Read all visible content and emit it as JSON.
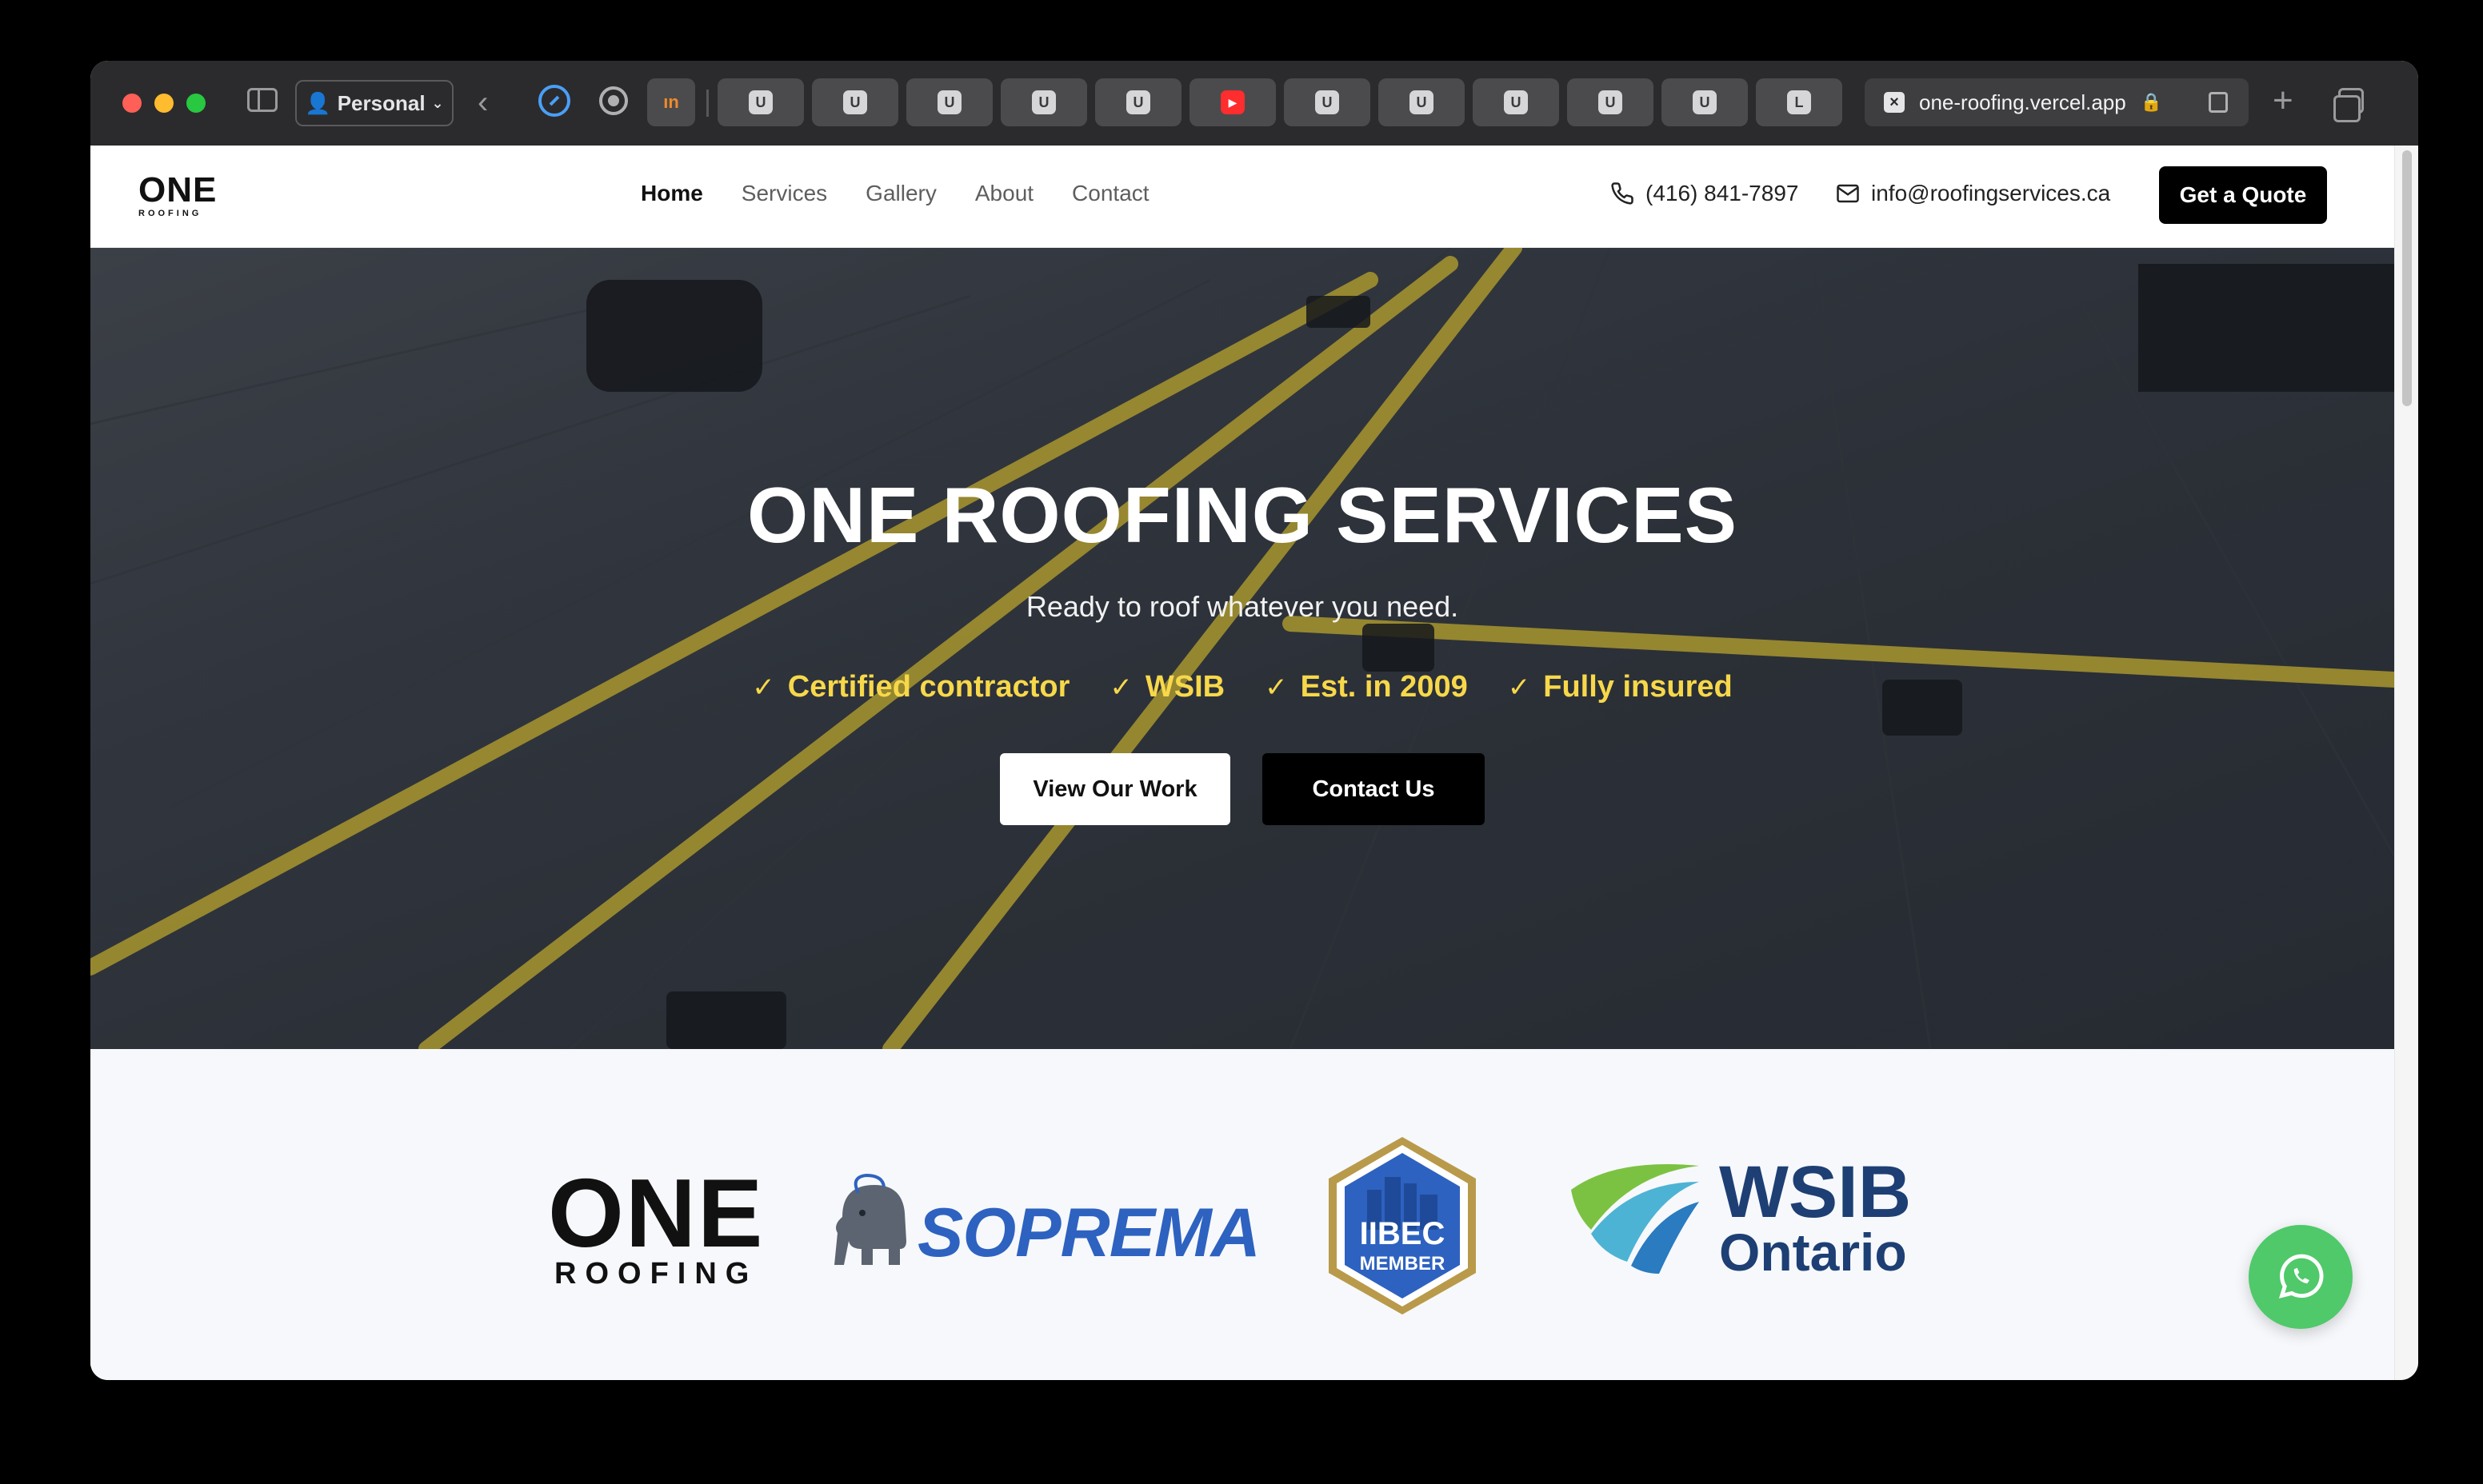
{
  "browser": {
    "profile_label": "Personal",
    "pinned_tab_label": "ın",
    "tabs": [
      {
        "favicon": "U"
      },
      {
        "favicon": "U"
      },
      {
        "favicon": "U"
      },
      {
        "favicon": "U"
      },
      {
        "favicon": "U"
      },
      {
        "favicon": "▶"
      },
      {
        "favicon": "U"
      },
      {
        "favicon": "U"
      },
      {
        "favicon": "U"
      },
      {
        "favicon": "U"
      },
      {
        "favicon": "U"
      },
      {
        "favicon": "L"
      }
    ],
    "active_tab": {
      "close_glyph": "×",
      "url": "one-roofing.vercel.app"
    }
  },
  "site": {
    "logo": {
      "line1": "ONE",
      "line2": "ROOFING"
    },
    "nav": [
      "Home",
      "Services",
      "Gallery",
      "About",
      "Contact"
    ],
    "phone": "(416) 841-7897",
    "email": "info@roofingservices.ca",
    "quote_label": "Get a Quote"
  },
  "hero": {
    "title": "ONE ROOFING SERVICES",
    "subtitle": "Ready to roof whatever you need.",
    "badges": [
      "Certified contractor",
      "WSIB",
      "Est. in 2009",
      "Fully insured"
    ],
    "primary_cta": "View Our Work",
    "secondary_cta": "Contact Us"
  },
  "partners": {
    "one": {
      "line1": "ONE",
      "line2": "ROOFING"
    },
    "soprema": "SOPREMA",
    "iibec": {
      "line1": "IIBEC",
      "line2": "MEMBER"
    },
    "wsib": {
      "line1": "WSIB",
      "line2": "Ontario"
    }
  },
  "colors": {
    "accent_yellow": "#f7d84a",
    "brand_blue": "#2e62c0",
    "wsib_navy": "#1d3f74",
    "whatsapp_green": "#4fc96a"
  }
}
